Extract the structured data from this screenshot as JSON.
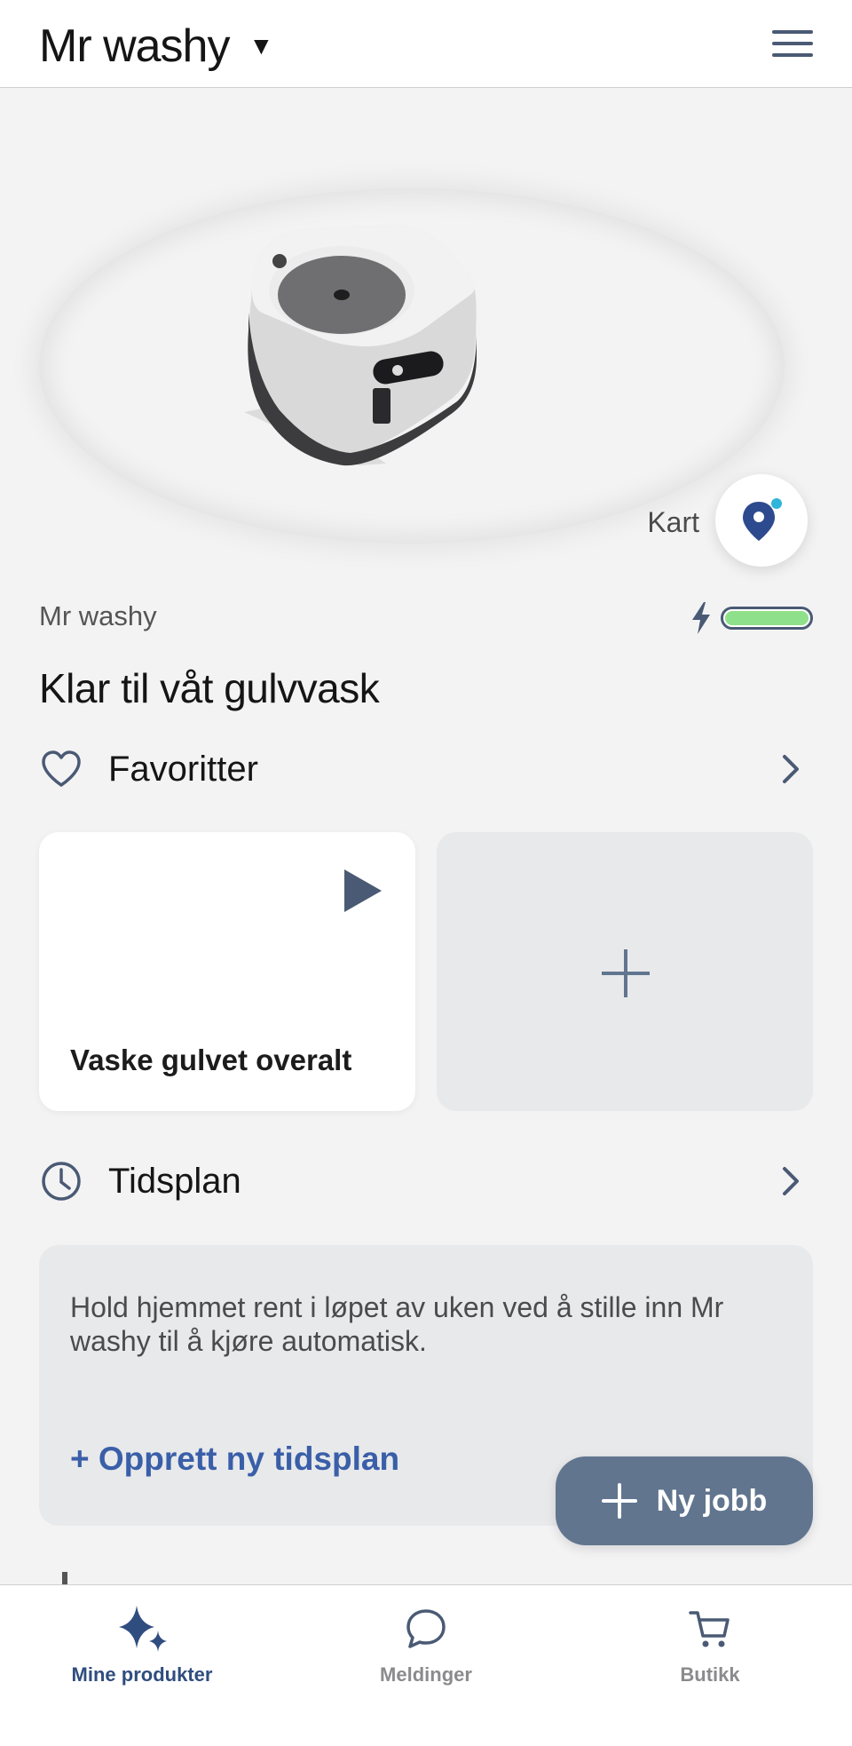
{
  "header": {
    "robot_name": "Mr washy",
    "caret": "▼",
    "menu_icon": "hamburger-menu-icon"
  },
  "hero": {
    "map_label": "Kart",
    "map_icon": "map-pin-icon"
  },
  "status": {
    "robot_name": "Mr washy",
    "battery_level": 1.0,
    "battery_icon": "charging-bolt-icon",
    "battery_color": "#8fe08a",
    "ready_text": "Klar til våt gulvvask"
  },
  "favorites": {
    "title": "Favoritter",
    "icon": "heart-icon",
    "card_label": "Vaske gulvet overalt"
  },
  "schedule": {
    "title": "Tidsplan",
    "icon": "clock-icon",
    "description": "Hold hjemmet rent i løpet av uken ved å stille inn Mr washy til å kjøre automatisk.",
    "create_link": "+ Opprett ny tidsplan"
  },
  "fab": {
    "label": "Ny jobb"
  },
  "tabs": [
    {
      "label": "Mine produkter",
      "icon": "sparkle-icon",
      "active": true
    },
    {
      "label": "Meldinger",
      "icon": "chat-bubble-icon",
      "active": false
    },
    {
      "label": "Butikk",
      "icon": "cart-icon",
      "active": false
    }
  ],
  "colors": {
    "accent": "#3a5fa8",
    "fab": "#61758f",
    "icon": "#4a5a74"
  }
}
